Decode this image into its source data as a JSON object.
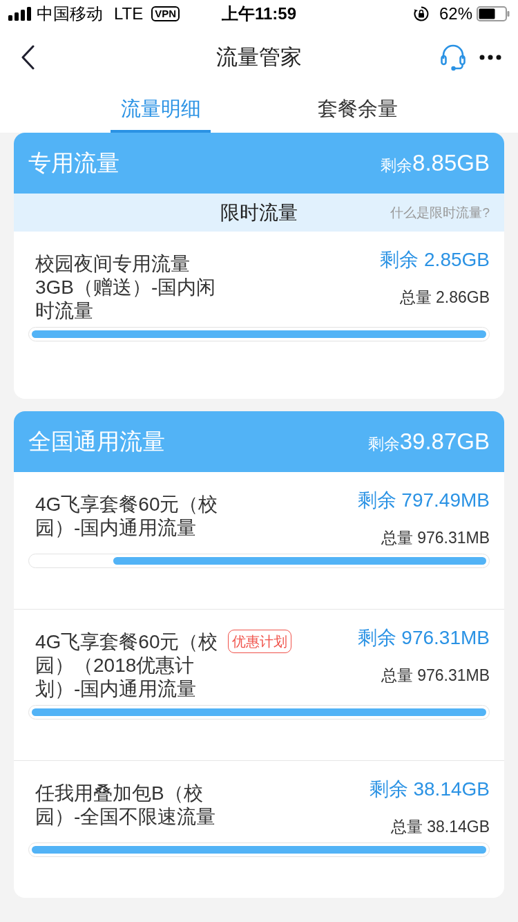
{
  "status_bar": {
    "carrier": "中国移动",
    "network": "LTE",
    "vpn": "VPN",
    "time": "上午11:59",
    "battery": "62%"
  },
  "nav_bar": {
    "title": "流量管家"
  },
  "tabs": [
    {
      "label": "流量明细",
      "selected": true
    },
    {
      "label": "套餐余量",
      "selected": false
    }
  ],
  "sections": [
    {
      "title": "专用流量",
      "remaining_label": "剩余",
      "remaining_value": "8.85GB",
      "subheader": {
        "title": "限时流量",
        "link": "什么是限时流量?"
      },
      "items": [
        {
          "name": "校园夜间专用流量3GB（赠送）-国内闲时流量",
          "remaining": "剩余 2.85GB",
          "total": "总量 2.86GB",
          "level": 1
        }
      ]
    },
    {
      "title": "全国通用流量",
      "remaining_label": "剩余",
      "remaining_value": "39.87GB",
      "items": [
        {
          "name": "4G飞享套餐60元（校园）-国内通用流量",
          "remaining": "剩余 797.49MB",
          "total": "总量 976.31MB",
          "level": 0.82
        },
        {
          "name": "4G飞享套餐60元（校园）（2018优惠计划）-国内通用流量",
          "badge": "优惠计划",
          "remaining": "剩余 976.31MB",
          "total": "总量 976.31MB",
          "level": 1
        },
        {
          "name": "任我用叠加包B（校园）-全国不限速流量",
          "remaining": "剩余 38.14GB",
          "total": "总量 38.14GB",
          "level": 1
        }
      ]
    }
  ]
}
